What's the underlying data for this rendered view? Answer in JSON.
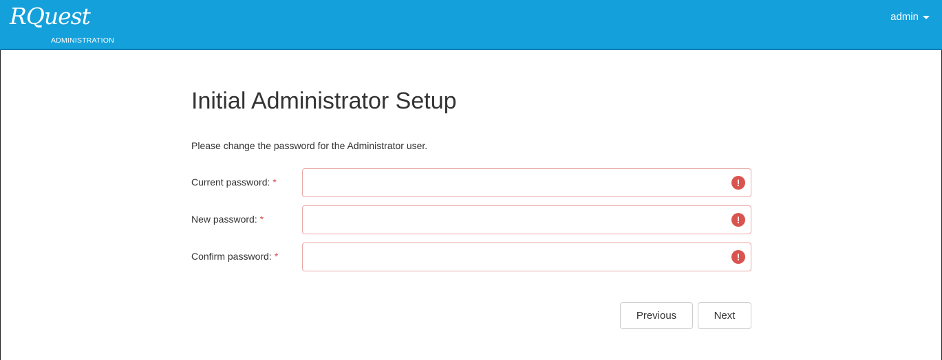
{
  "header": {
    "logo_text": "RQuest",
    "logo_subtitle": "ADMINISTRATION",
    "user_menu_label": "admin",
    "bar_color": "#14a0db"
  },
  "main": {
    "title": "Initial Administrator Setup",
    "intro": "Please change the password for the Administrator user.",
    "fields": [
      {
        "label": "Current password:",
        "required_marker": "*",
        "value": "",
        "error_icon": "exclamation-circle-icon"
      },
      {
        "label": "New password:",
        "required_marker": "*",
        "value": "",
        "error_icon": "exclamation-circle-icon"
      },
      {
        "label": "Confirm password:",
        "required_marker": "*",
        "value": "",
        "error_icon": "exclamation-circle-icon"
      }
    ],
    "buttons": {
      "previous": "Previous",
      "next": "Next"
    },
    "colors": {
      "error": "#d9534f",
      "error_border": "#e8a6a4"
    }
  }
}
